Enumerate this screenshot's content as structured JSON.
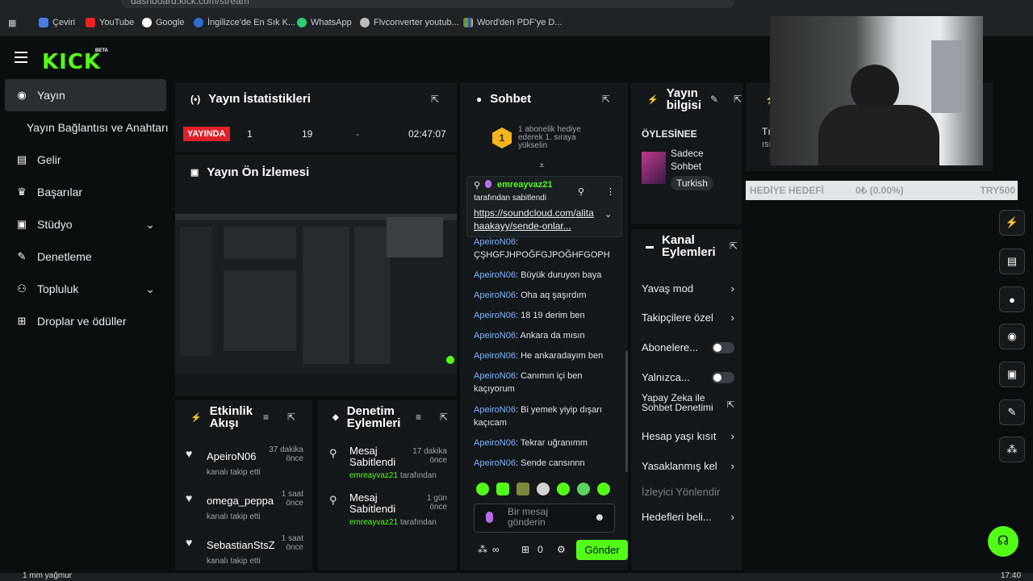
{
  "browser": {
    "url": "dashboard.kick.com/stream",
    "bookmarks": [
      "Çeviri",
      "YouTube",
      "Google",
      "İngilizce'de En Sık K...",
      "WhatsApp",
      "Flvconverter youtub...",
      "Word'den PDF'ye D..."
    ]
  },
  "brand": {
    "logo": "KICK",
    "beta": "BETA"
  },
  "sidebar": {
    "items": [
      {
        "label": "Yayın",
        "icon": "broadcast-icon"
      },
      {
        "label": "Yayın Bağlantısı ve Anahtarı",
        "icon": ""
      },
      {
        "label": "Gelir",
        "icon": "chart-icon"
      },
      {
        "label": "Başarılar",
        "icon": "trophy-icon"
      },
      {
        "label": "Stüdyo",
        "icon": "studio-icon"
      },
      {
        "label": "Denetleme",
        "icon": "wrench-icon"
      },
      {
        "label": "Topluluk",
        "icon": "users-icon"
      },
      {
        "label": "Droplar ve ödüller",
        "icon": "gift-icon"
      }
    ]
  },
  "stats": {
    "title": "Yayın İstatistikleri",
    "live": "YAYINDA",
    "viewers": "1",
    "followers": "19",
    "subs": "-",
    "duration": "02:47:07"
  },
  "preview": {
    "title": "Yayın Ön İzlemesi"
  },
  "activity": {
    "title": "Etkinlik Akışı",
    "items": [
      {
        "name": "ApeiroN06",
        "sub": "kanalı takip etti",
        "time": "37 dakika önce"
      },
      {
        "name": "omega_peppa",
        "sub": "kanalı takip etti",
        "time": "1 saat önce"
      },
      {
        "name": "SebastianStsZ",
        "sub": "kanalı takip etti",
        "time": "1 saat önce"
      }
    ]
  },
  "modactions": {
    "title": "Denetim Eylemleri",
    "items": [
      {
        "action": "Mesaj Sabitlendi",
        "by": "emreayvaz21",
        "suffix": "tarafından",
        "time": "17 dakika önce"
      },
      {
        "action": "Mesaj Sabitlendi",
        "by": "emreayvaz21",
        "suffix": "tarafından",
        "time": "1 gün önce"
      }
    ]
  },
  "chat": {
    "title": "Sohbet",
    "sub_goal": "1 abonelik hediye ederek 1. sıraya yükselin",
    "sub_rank": "1",
    "pinned_user": "emreayvaz21",
    "pinned_by": "tarafından sabitlendi",
    "pinned_link": "https://soundcloud.com/alitahaakayy/sende-onlar...",
    "messages": [
      {
        "user": "ApeiroN06",
        "text": "ÇŞHGFJHPOĞFGJPOĞHFGOPH"
      },
      {
        "user": "ApeiroN06",
        "text": "Büyük duruyon baya"
      },
      {
        "user": "ApeiroN06",
        "text": "Oha aq şaşırdım"
      },
      {
        "user": "ApeiroN06",
        "text": "18 19 derim ben"
      },
      {
        "user": "ApeiroN06",
        "text": "Ankara da mısın"
      },
      {
        "user": "ApeiroN06",
        "text": "He ankaradayım ben"
      },
      {
        "user": "ApeiroN06",
        "text": "Canımın içi ben kaçıyorum"
      },
      {
        "user": "ApeiroN06",
        "text": "Bi yemek yiyip dışarı kaçıcam"
      },
      {
        "user": "ApeiroN06",
        "text": "Tekrar uğranımm"
      },
      {
        "user": "ApeiroN06",
        "text": "Sende cansınnn"
      }
    ],
    "placeholder": "Bir mesaj gönderin",
    "points": "∞",
    "count": "0",
    "send": "Gönder"
  },
  "streaminfo": {
    "title": "Yayın bilgisi",
    "stream_title": "ÖYLESİNEE",
    "category": "Sadece Sohbet",
    "language": "Turkish"
  },
  "channel": {
    "title": "Kanal Eylemleri",
    "items": [
      {
        "label": "Yavaş mod",
        "type": "arrow"
      },
      {
        "label": "Takipçilere özel",
        "type": "arrow"
      },
      {
        "label": "Abonelere...",
        "type": "toggle"
      },
      {
        "label": "Yalnızca...",
        "type": "toggle"
      },
      {
        "label": "Yapay Zeka ile Sohbet Denetimi",
        "type": "external"
      },
      {
        "label": "Hesap yaşı kısıt",
        "type": "arrow"
      },
      {
        "label": "Yasaklanmış kel",
        "type": "arrow"
      },
      {
        "label": "İzleyici Yönlendir",
        "type": "disabled"
      },
      {
        "label": "Hedefleri beli...",
        "type": "arrow"
      }
    ]
  },
  "extra": {
    "title_stub": "Tı",
    "sub_stub": "ısı"
  },
  "goal": {
    "label": "HEDİYE HEDEFİ",
    "value": "0₺ (0.00%)",
    "target": "TRY500"
  },
  "taskbar": {
    "weather": "1 mm yağmur",
    "time": "17:40"
  }
}
